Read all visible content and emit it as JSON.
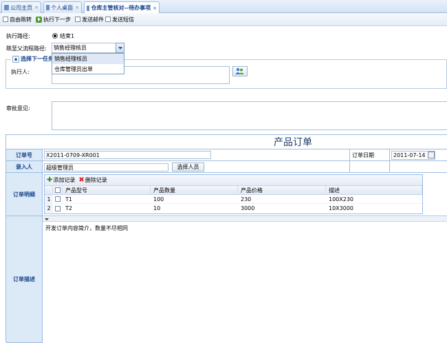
{
  "tabs": [
    {
      "label": "公司主页",
      "close": "×"
    },
    {
      "label": "个人桌面",
      "close": "×"
    },
    {
      "label": "仓库主管核对--待办事项",
      "close": "×"
    }
  ],
  "toolbar": {
    "free_jump": "自由跳转",
    "next_step": "执行下一步",
    "send_mail": "发送邮件",
    "send_sms": "发送短信"
  },
  "form": {
    "exec_path_label": "执行路径:",
    "exec_path_value": "结束1",
    "jump_label": "跳至父流程路径:",
    "jump_value": "销售经理核员",
    "dropdown_options": [
      "销售经理核员",
      "仓库管理员出单"
    ],
    "next_task_legend": "选择下一任务",
    "executor_label": "执行人:",
    "executor_value": "",
    "approval_label": "审批意见:"
  },
  "order": {
    "title": "产品订单",
    "order_no_label": "订单号",
    "order_no": "X2011-0709-XR001",
    "order_date_label": "订单日期",
    "order_date": "2011-07-14",
    "entry_label": "录入人",
    "entry_value": "超级管理员",
    "select_person": "选择人员",
    "detail_label": "订单明细",
    "add_record": "添加记录",
    "delete_record": "删除记录",
    "columns": [
      "产品型号",
      "产品数量",
      "产品价格",
      "描述"
    ],
    "rows": [
      {
        "no": "1",
        "model": "T1",
        "qty": "100",
        "price": "230",
        "desc": "100X230"
      },
      {
        "no": "2",
        "model": "T2",
        "qty": "10",
        "price": "3000",
        "desc": "10X3000"
      }
    ],
    "desc_label": "订单描述",
    "desc_text": "开发订单内容简介，数量不尽相同"
  }
}
